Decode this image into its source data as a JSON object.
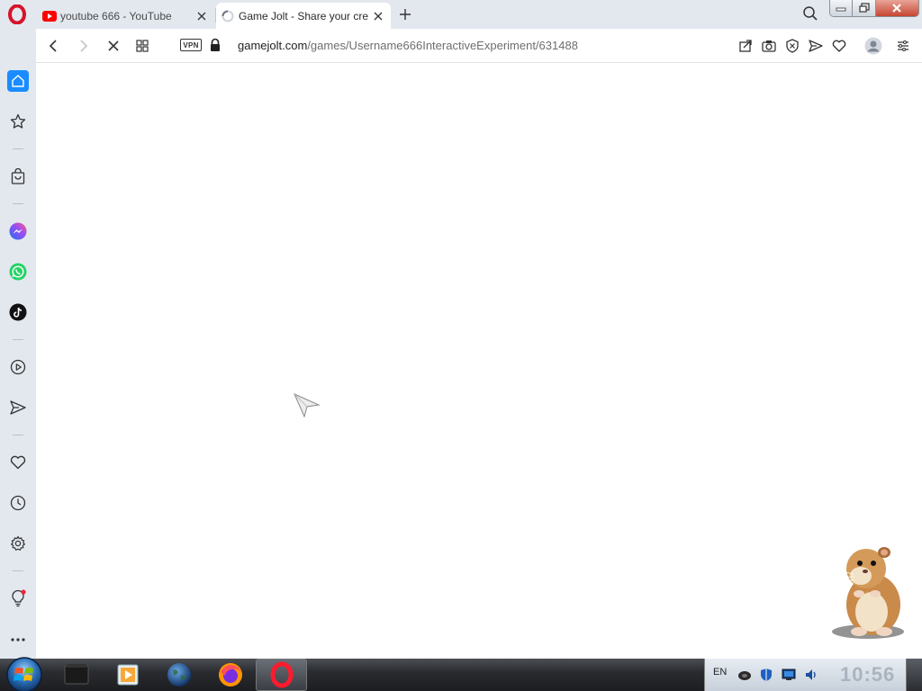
{
  "browser": {
    "tabs": [
      {
        "title": "youtube 666 - YouTube",
        "favicon": "youtube-icon",
        "active": false
      },
      {
        "title": "Game Jolt - Share your cre",
        "favicon": "loading-spinner-icon",
        "active": true
      }
    ],
    "address": {
      "vpn_label": "VPN",
      "url_host": "gamejolt.com",
      "url_path": "/games/Username666InteractiveExperiment/631488"
    }
  },
  "sidebar": {
    "items": [
      "home-icon",
      "bookmarks-star-icon",
      "shopping-bag-icon",
      "messenger-icon",
      "whatsapp-icon",
      "tiktok-icon",
      "player-icon",
      "send-icon",
      "heart-icon",
      "history-clock-icon",
      "settings-gear-icon",
      "tips-bulb-icon",
      "more-icon"
    ]
  },
  "taskbar": {
    "apps": [
      "terminal-icon",
      "media-player-icon",
      "earth-globe-icon",
      "firefox-icon",
      "opera-icon"
    ],
    "tray": {
      "language": "EN",
      "clock": "10:56"
    }
  },
  "colors": {
    "accent": "#1a8cff",
    "opera_red": "#d6142b",
    "chrome_bg": "#e3e8ef"
  }
}
